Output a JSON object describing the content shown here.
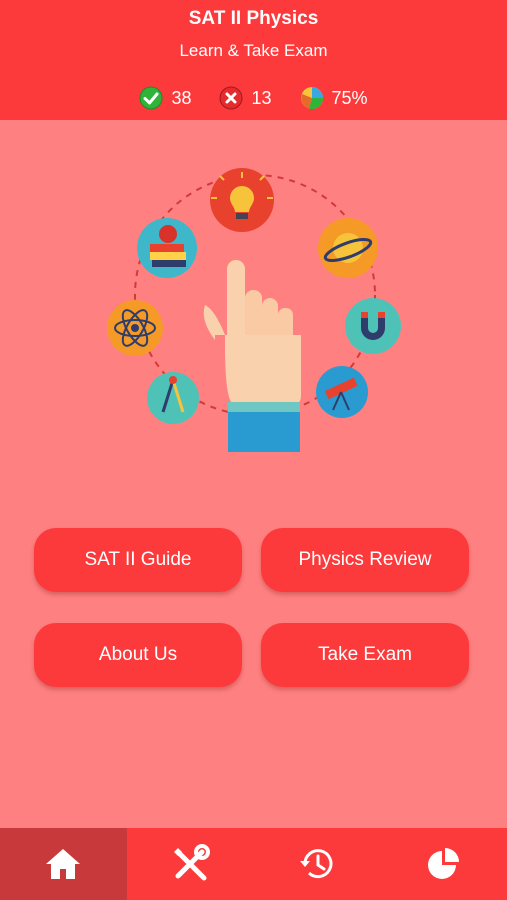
{
  "header": {
    "title": "SAT II Physics",
    "subtitle": "Learn & Take Exam",
    "stats": {
      "correct": "38",
      "wrong": "13",
      "percent": "75%"
    }
  },
  "menu": {
    "guide_label": "SAT II Guide",
    "review_label": "Physics Review",
    "about_label": "About Us",
    "exam_label": "Take Exam"
  },
  "tabbar": {
    "tabs": [
      {
        "icon": "home-icon",
        "active": true
      },
      {
        "icon": "tools-icon",
        "active": false
      },
      {
        "icon": "history-icon",
        "active": false
      },
      {
        "icon": "pie-chart-icon",
        "active": false
      }
    ]
  },
  "colors": {
    "header_bg": "#fc3a3c",
    "body_bg": "#ff8080",
    "button_bg": "#fc3a3c",
    "active_tab_bg": "#c8393b"
  }
}
